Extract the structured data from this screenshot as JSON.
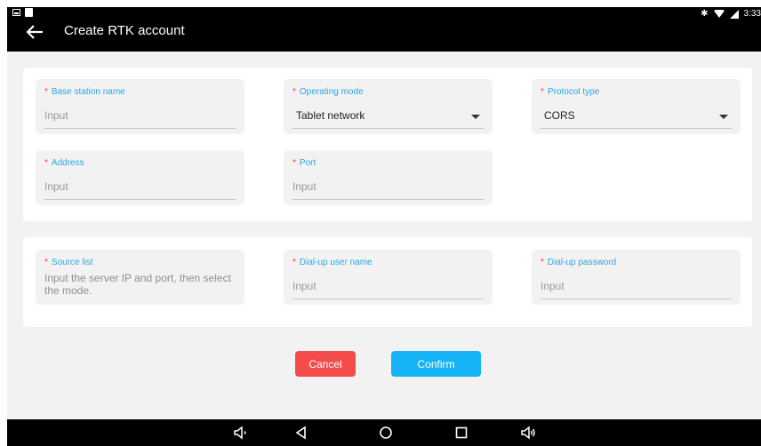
{
  "header": {
    "title": "Create RTK account",
    "time": "3:33"
  },
  "card1": {
    "base_station": {
      "label": "Base station name",
      "placeholder": "Input"
    },
    "operating_mode": {
      "label": "Operating mode",
      "value": "Tablet network"
    },
    "protocol_type": {
      "label": "Protocol type",
      "value": "CORS"
    },
    "address": {
      "label": "Address",
      "placeholder": "Input"
    },
    "port": {
      "label": "Port",
      "placeholder": "Input"
    }
  },
  "card2": {
    "source_list": {
      "label": "Source list",
      "hint": "Input the server IP and port, then select the mode."
    },
    "dialup_user": {
      "label": "Dial-up user name",
      "placeholder": "Input"
    },
    "dialup_password": {
      "label": "Dial-up password",
      "placeholder": "Input"
    }
  },
  "buttons": {
    "cancel": "Cancel",
    "confirm": "Confirm"
  },
  "required_mark": "*",
  "colors": {
    "accent": "#2aa7e4",
    "required": "#ff3b3b",
    "cancel": "#f44b4b",
    "confirm": "#16b4f6"
  }
}
